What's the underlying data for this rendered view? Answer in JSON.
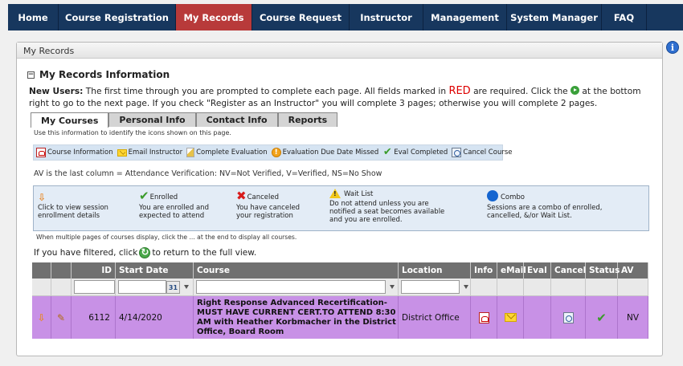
{
  "nav": {
    "items": [
      {
        "label": "Home",
        "name": "nav-home"
      },
      {
        "label": "Course Registration",
        "name": "nav-course-registration"
      },
      {
        "label": "My Records",
        "name": "nav-my-records"
      },
      {
        "label": "Course Request",
        "name": "nav-course-request"
      },
      {
        "label": "Instructor",
        "name": "nav-instructor"
      },
      {
        "label": "Management",
        "name": "nav-management"
      },
      {
        "label": "System Manager",
        "name": "nav-system-manager"
      },
      {
        "label": "FAQ",
        "name": "nav-faq"
      }
    ],
    "active": "My Records"
  },
  "panel": {
    "title": "My Records",
    "section_title": "My Records Information",
    "intro": {
      "lead": "New Users:",
      "part1": " The first time through you are prompted to complete each page. All fields marked in ",
      "red_word": "RED",
      "part2": " are required. Click the ",
      "part3": " at the bottom right to go to the next page. If you check \"Register as an Instructor\" you will complete 3 pages; otherwise you will complete 2 pages."
    }
  },
  "tabs": [
    "My Courses",
    "Personal Info",
    "Contact Info",
    "Reports"
  ],
  "icon_legend": {
    "hint": "Use this information to identify the icons shown on this page.",
    "items": [
      {
        "icon": "pdf-icon",
        "label": "Course Information"
      },
      {
        "icon": "mail-icon",
        "label": "Email Instructor"
      },
      {
        "icon": "evaluation-icon",
        "label": "Complete Evaluation"
      },
      {
        "icon": "due-date-icon",
        "label": "Evaluation Due Date Missed"
      },
      {
        "icon": "check-icon",
        "label": "Eval Completed"
      },
      {
        "icon": "cancel-course-icon",
        "label": "Cancel Course"
      }
    ]
  },
  "av_note": "AV is the last column = Attendance Verification: NV=Not Verified, V=Verified, NS=No Show",
  "status_legend": [
    {
      "icon": "arrow-down-icon",
      "title": "",
      "text1": "Click to view session",
      "text2": "enrollment details",
      "text3": ""
    },
    {
      "icon": "check-icon",
      "title": "Enrolled",
      "text1": "You are enrolled and",
      "text2": "expected to attend",
      "text3": ""
    },
    {
      "icon": "x-icon",
      "title": "Canceled",
      "text1": "You have canceled",
      "text2": "your registration",
      "text3": ""
    },
    {
      "icon": "warning-icon",
      "title": "Wait List",
      "text1": "Do not attend unless you are",
      "text2": "notified a seat becomes available",
      "text3": "and you are enrolled."
    },
    {
      "icon": "combo-icon",
      "title": "Combo",
      "text1": "Sessions are a combo of enrolled,",
      "text2": "cancelled, &/or Wait List.",
      "text3": ""
    }
  ],
  "pages_note": "When multiple pages of courses display, click the ... at the end to display all courses.",
  "filter_note": {
    "before": "If you have filtered, click",
    "after": "to return to the full view."
  },
  "grid": {
    "columns": [
      "",
      "",
      "ID",
      "Start Date",
      "Course",
      "Location",
      "Info",
      "eMail",
      "Eval",
      "Cancel",
      "Status",
      "AV"
    ],
    "calendar_label": "31",
    "rows": [
      {
        "id": "6112",
        "start_date": "4/14/2020",
        "course": "Right Response Advanced Recertification- MUST HAVE CURRENT CERT.TO ATTEND 8:30 AM with Heather Korbmacher in the District Office, Board Room",
        "location": "District Office",
        "av": "NV"
      }
    ]
  },
  "colors": {
    "nav_bg": "#17375e",
    "nav_active": "#b83a3a",
    "row_highlight": "#c891e6",
    "grid_header": "#707070"
  }
}
